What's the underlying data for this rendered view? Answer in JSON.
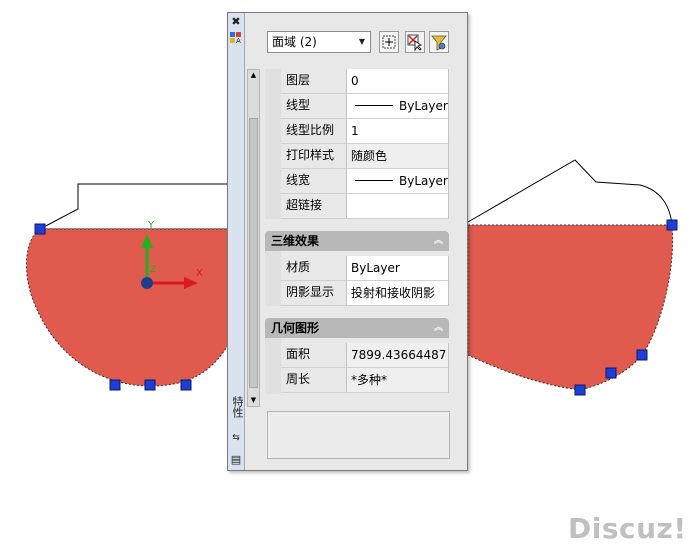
{
  "palette": {
    "title": "特性",
    "close_glyph": "✖",
    "autohide_glyph": "⇆",
    "menu_glyph": "▤"
  },
  "selector": {
    "value": "面域 (2)"
  },
  "general": {
    "rows": [
      {
        "label": "图层",
        "value": "0"
      },
      {
        "label": "线型",
        "value": "ByLayer",
        "line": true
      },
      {
        "label": "线型比例",
        "value": "1"
      },
      {
        "label": "打印样式",
        "value": "随颜色"
      },
      {
        "label": "线宽",
        "value": "ByLayer",
        "line": true
      },
      {
        "label": "超链接",
        "value": ""
      }
    ]
  },
  "three_d": {
    "title": "三维效果",
    "rows": [
      {
        "label": "材质",
        "value": "ByLayer"
      },
      {
        "label": "阴影显示",
        "value": "投射和接收阴影"
      }
    ]
  },
  "geometry": {
    "title": "几何图形",
    "rows": [
      {
        "label": "面积",
        "value": "7899.43664487"
      },
      {
        "label": "周长",
        "value": "*多种*"
      }
    ]
  },
  "ucs": {
    "y_label": "Y",
    "x_label": "X",
    "z_label": "Z"
  },
  "colors": {
    "region_fill": "#e05a4e",
    "grip": "#1e3ed6",
    "palette_bg": "#e8e8e8"
  },
  "watermark": "Discuz!"
}
